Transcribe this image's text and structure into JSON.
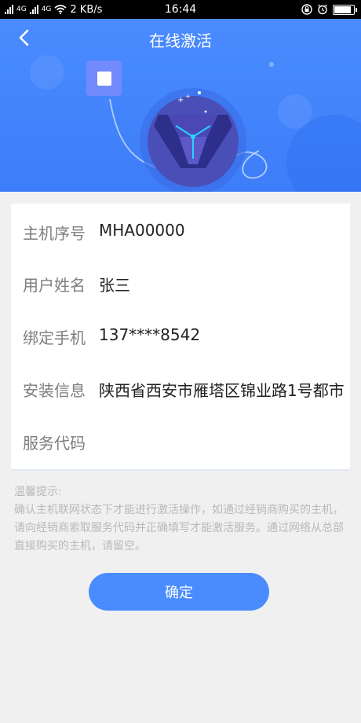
{
  "status_bar": {
    "network_left": "4G",
    "network_right": "4G",
    "speed": "2 KB/s",
    "time": "16:44"
  },
  "header": {
    "title": "在线激活"
  },
  "form": {
    "fields": [
      {
        "label": "主机序号",
        "value": "MHA00000"
      },
      {
        "label": "用户姓名",
        "value": "张三"
      },
      {
        "label": "绑定手机",
        "value": "137****8542"
      },
      {
        "label": "安装信息",
        "value": "陕西省西安市雁塔区锦业路1号都市"
      },
      {
        "label": "服务代码",
        "value": ""
      }
    ]
  },
  "tips": {
    "title": "温馨提示:",
    "body": "确认主机联网状态下才能进行激活操作，如通过经销商购买的主机，请向经销商索取服务代码并正确填写才能激活服务。通过网络从总部直接购买的主机，请留空。"
  },
  "confirm_button": "确定",
  "colors": {
    "header": "#4a8cff",
    "button": "#4a8cff",
    "background": "#f0f0f0"
  }
}
